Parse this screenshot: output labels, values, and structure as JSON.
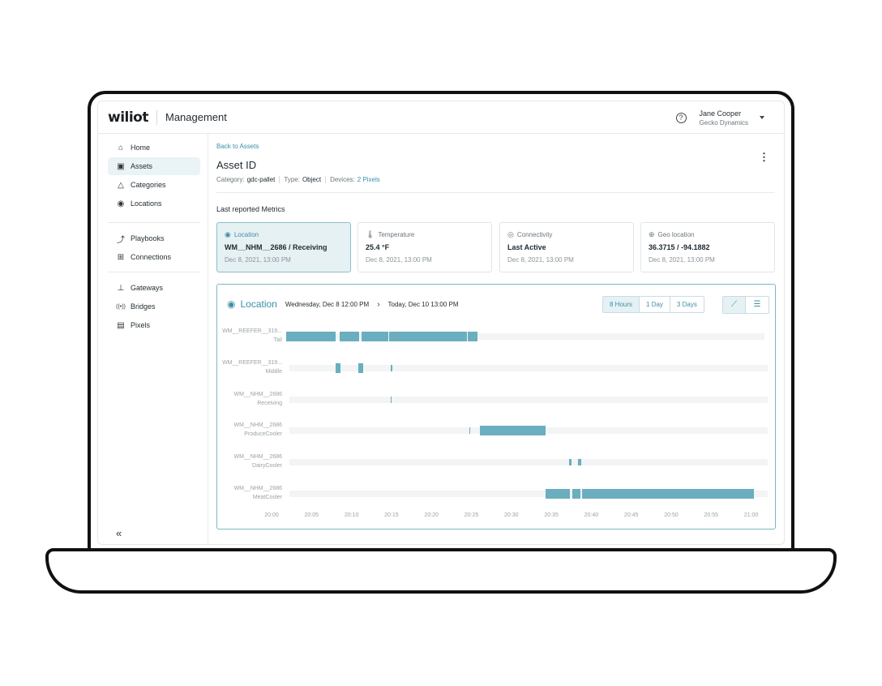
{
  "app": {
    "logo": "wiliot",
    "title": "Management"
  },
  "user": {
    "name": "Jane Cooper",
    "org": "Gecko Dynamics"
  },
  "nav": {
    "items": [
      {
        "label": "Home",
        "icon": "home-icon",
        "glyph": "⌂"
      },
      {
        "label": "Assets",
        "icon": "box-icon",
        "glyph": "▣",
        "active": true
      },
      {
        "label": "Categories",
        "icon": "shapes-icon",
        "glyph": "△"
      },
      {
        "label": "Locations",
        "icon": "pin-icon",
        "glyph": "◉"
      },
      {
        "label": "Playbooks",
        "icon": "playbook-icon",
        "glyph": "⤴"
      },
      {
        "label": "Connections",
        "icon": "connections-icon",
        "glyph": "⊞"
      },
      {
        "label": "Gateways",
        "icon": "gateway-icon",
        "glyph": "⊥"
      },
      {
        "label": "Bridges",
        "icon": "bridge-icon",
        "glyph": "((•))"
      },
      {
        "label": "Pixels",
        "icon": "pixel-icon",
        "glyph": "▤"
      }
    ],
    "collapse": "«"
  },
  "asset": {
    "back": "Back to Assets",
    "title": "Asset ID",
    "category_label": "Category:",
    "category": "gdc-pallet",
    "type_label": "Type:",
    "type": "Object",
    "devices_label": "Devices:",
    "devices": "2 Pixels"
  },
  "metrics": {
    "heading": "Last reported Metrics",
    "cards": [
      {
        "label": "Location",
        "icon": "pin-icon",
        "glyph": "◉",
        "value": "WM__NHM__2686 / Receiving",
        "time": "Dec 8, 2021, 13:00 PM",
        "active": true
      },
      {
        "label": "Temperature",
        "icon": "thermometer-icon",
        "glyph": "🌡",
        "value": "25.4 °F",
        "time": "Dec 8, 2021, 13:00 PM"
      },
      {
        "label": "Connectivity",
        "icon": "signal-icon",
        "glyph": "◎",
        "value": "Last Active",
        "time": "Dec 8, 2021, 13:00 PM"
      },
      {
        "label": "Geo location",
        "icon": "crosshair-icon",
        "glyph": "⊕",
        "value": "36.3715 / -94.1882",
        "time": "Dec 8, 2021, 13:00 PM"
      }
    ]
  },
  "timeline": {
    "title": "Location",
    "range_start": "Wednesday, Dec 8 12:00 PM",
    "range_end": "Today, Dec 10 13:00 PM",
    "ranges": [
      {
        "label": "8 Hours",
        "selected": true
      },
      {
        "label": "1 Day"
      },
      {
        "label": "3 Days"
      }
    ],
    "views": [
      {
        "icon": "line-chart-icon",
        "glyph": "⟋",
        "selected": true
      },
      {
        "icon": "list-icon",
        "glyph": "☰"
      }
    ],
    "ticks": [
      "20:00",
      "20:05",
      "20:10",
      "20:15",
      "20:20",
      "20:25",
      "20:30",
      "20:35",
      "20:40",
      "20:45",
      "20:50",
      "20:55",
      "21:00"
    ],
    "rows": [
      {
        "line1": "WM__REEFER__319...",
        "line2": "Tail",
        "spans": [
          [
            0.0,
            5.2
          ],
          [
            5.6,
            7.6
          ],
          [
            7.9,
            10.7
          ],
          [
            10.8,
            18.9
          ],
          [
            19.0,
            20.0
          ]
        ]
      },
      {
        "line1": "WM__REEFER__319...",
        "line2": "Middle",
        "spans": [
          [
            4.8,
            5.3
          ],
          [
            7.2,
            7.7
          ],
          [
            10.6,
            10.8
          ]
        ]
      },
      {
        "line1": "WM__NHM__2686",
        "line2": "Receiving",
        "spans": [
          [
            10.6,
            10.7
          ]
        ]
      },
      {
        "line1": "WM__NHM__2686",
        "line2": "ProduceCooler",
        "spans": [
          [
            18.8,
            18.9
          ],
          [
            19.9,
            26.8
          ]
        ]
      },
      {
        "line1": "WM__NHM__2686",
        "line2": "DairyCooler",
        "spans": [
          [
            29.2,
            29.5
          ],
          [
            30.2,
            30.5
          ]
        ]
      },
      {
        "line1": "WM__NHM__2686",
        "line2": "MeatCooler",
        "spans": [
          [
            26.8,
            29.3
          ],
          [
            29.6,
            30.4
          ],
          [
            30.6,
            48.6
          ]
        ]
      }
    ],
    "x_range_minutes": [
      0,
      50
    ]
  },
  "colors": {
    "accent": "#3d8fa6",
    "bar": "#6aaebf",
    "track": "#f2f4f5"
  }
}
